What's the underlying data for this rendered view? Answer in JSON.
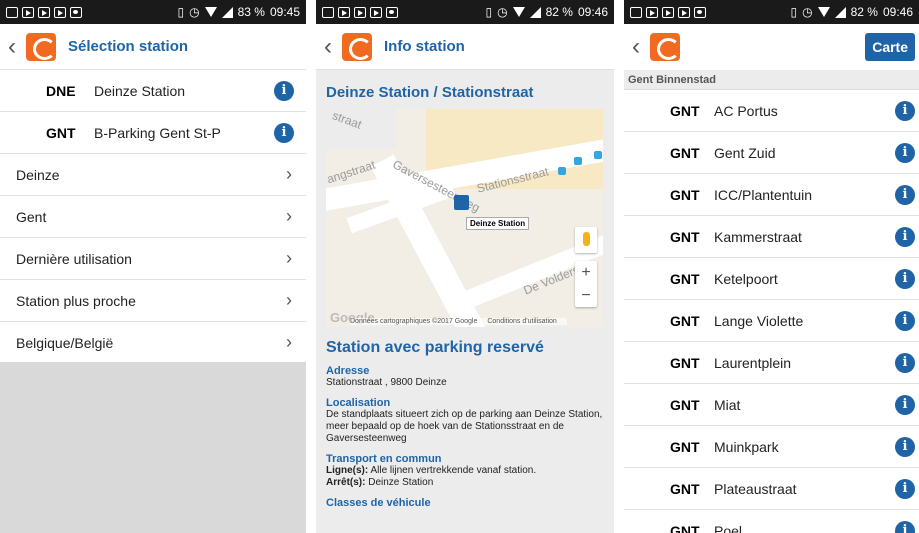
{
  "panel1": {
    "status": {
      "battery": "83 %",
      "time": "09:45"
    },
    "title": "Sélection station",
    "favorites": [
      {
        "code": "DNE",
        "name": "Deinze Station"
      },
      {
        "code": "GNT",
        "name": "B-Parking Gent St-P"
      }
    ],
    "nav": [
      "Deinze",
      "Gent",
      "Dernière utilisation",
      "Station plus proche",
      "Belgique/België"
    ]
  },
  "panel2": {
    "status": {
      "battery": "82 %",
      "time": "09:46"
    },
    "title": "Info station",
    "station_title": "Deinze Station / Stationstraat",
    "map": {
      "streets": [
        "Stationsstraat",
        "Gaversesteenweg",
        "De Volders",
        "angstraat",
        "straat"
      ],
      "marker_label": "Deinze Station",
      "google": "Google",
      "footer_data": "Données cartographiques ©2017 Google",
      "footer_terms": "Conditions d'utilisation"
    },
    "section_title": "Station avec parking reservé",
    "adresse_h": "Adresse",
    "adresse": "Stationstraat , 9800 Deinze",
    "localisation_h": "Localisation",
    "localisation": "De standplaats situeert zich op de parking aan Deinze Station, meer bepaald op de hoek van de Stationsstraat en de Gaversesteenweg",
    "transport_h": "Transport en commun",
    "ligne_label": "Ligne(s):",
    "ligne_val": "Alle lijnen vertrekkende vanaf station.",
    "arret_label": "Arrêt(s):",
    "arret_val": "Deinze Station",
    "classes_h": "Classes de véhicule"
  },
  "panel3": {
    "status": {
      "battery": "82 %",
      "time": "09:46"
    },
    "carte": "Carte",
    "section": "Gent Binnenstad",
    "stations": [
      {
        "code": "GNT",
        "name": "AC Portus"
      },
      {
        "code": "GNT",
        "name": "Gent Zuid"
      },
      {
        "code": "GNT",
        "name": "ICC/Plantentuin"
      },
      {
        "code": "GNT",
        "name": "Kammerstraat"
      },
      {
        "code": "GNT",
        "name": "Ketelpoort"
      },
      {
        "code": "GNT",
        "name": "Lange Violette"
      },
      {
        "code": "GNT",
        "name": "Laurentplein"
      },
      {
        "code": "GNT",
        "name": "Miat"
      },
      {
        "code": "GNT",
        "name": "Muinkpark"
      },
      {
        "code": "GNT",
        "name": "Plateaustraat"
      },
      {
        "code": "GNT",
        "name": "Poel"
      }
    ]
  },
  "colors": {
    "brand_orange": "#f26a21",
    "brand_blue": "#1f64a6"
  }
}
